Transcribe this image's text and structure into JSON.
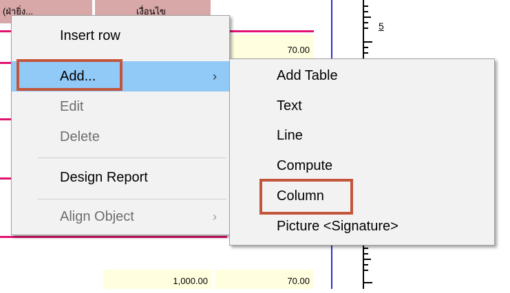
{
  "report": {
    "header_cells": [
      "(ฝ่ายิ่ง...",
      "เงื่อนไข"
    ],
    "row1_value": "70.00",
    "bottom_row": {
      "amount": "1,000.00",
      "value": "70.00"
    },
    "ruler_label": "5"
  },
  "context_menu": {
    "items": [
      {
        "label": "Insert row",
        "enabled": true
      },
      {
        "label": "Add...",
        "enabled": true,
        "has_submenu": true
      },
      {
        "label": "Edit",
        "enabled": false
      },
      {
        "label": "Delete",
        "enabled": false
      },
      {
        "label": "Design Report",
        "enabled": true
      },
      {
        "label": "Align Object",
        "enabled": false,
        "has_submenu": true
      }
    ],
    "submenu_arrow": "›",
    "highlight_color": "#91c9f7"
  },
  "submenu": {
    "items": [
      {
        "label": "Add Table"
      },
      {
        "label": "Text"
      },
      {
        "label": "Line"
      },
      {
        "label": "Compute"
      },
      {
        "label": "Column"
      },
      {
        "label": "Picture <Signature>"
      }
    ]
  },
  "annotation_color": "#c2553a"
}
